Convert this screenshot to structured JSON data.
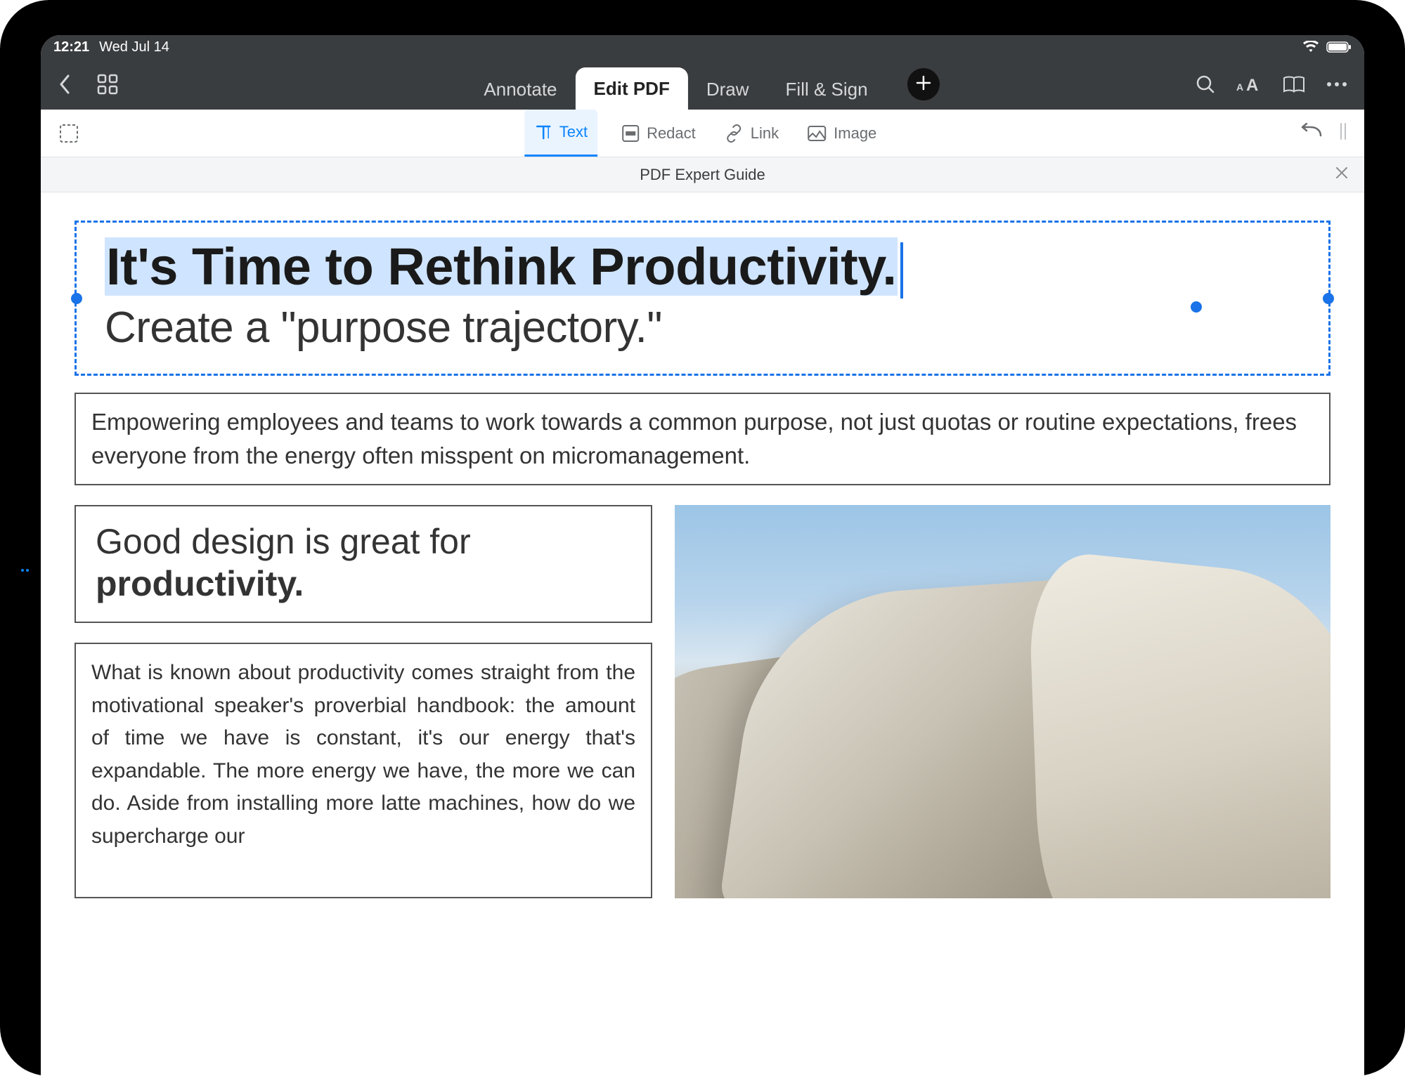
{
  "status": {
    "time": "12:21",
    "date": "Wed Jul 14"
  },
  "toolbar": {
    "tabs": [
      {
        "label": "Annotate"
      },
      {
        "label": "Edit PDF"
      },
      {
        "label": "Draw"
      },
      {
        "label": "Fill & Sign"
      }
    ],
    "active_tab_index": 1
  },
  "subtoolbar": {
    "tools": [
      {
        "label": "Text"
      },
      {
        "label": "Redact"
      },
      {
        "label": "Link"
      },
      {
        "label": "Image"
      }
    ],
    "active_tool_index": 0
  },
  "document": {
    "title": "PDF Expert Guide",
    "headline": "It's Time to Rethink Productivity.",
    "subheadline": "Create a \"purpose trajectory.\"",
    "intro_paragraph": "Empowering employees and teams to work towards a common purpose, not just quotas or routine expectations, frees everyone from the energy often misspent on micromanagement.",
    "design_heading_prefix": "Good design is great for ",
    "design_heading_bold": "productivity.",
    "body_paragraph": "What is known about productivity comes straight from the motivational speaker's proverbial handbook: the amount of time we have is constant, it's our energy that's expandable. The more energy we have, the more we can do. Aside from installing more latte machines, how do we supercharge our"
  }
}
